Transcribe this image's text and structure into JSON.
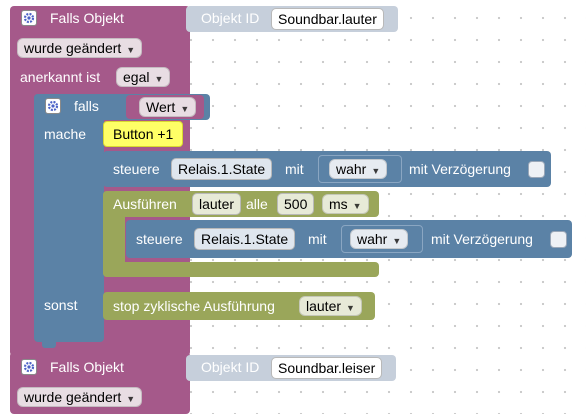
{
  "colors": {
    "trigger_block": "#a5598a",
    "if_block": "#5b82a6",
    "timer_block": "#9aa65a",
    "comment": "#ffff66",
    "value_pill": "#c6cfdb",
    "dropdown_bg": "#e6e6e6"
  },
  "trigger1": {
    "title": "Falls Objekt",
    "object_id_label": "Objekt ID",
    "object_id_value": "Soundbar.lauter",
    "condition_value": "wurde geändert",
    "ack_label": "anerkannt ist",
    "ack_value": "egal"
  },
  "if_block": {
    "if_label": "falls",
    "condition_value": "Wert",
    "do_label": "mache",
    "else_label": "sonst"
  },
  "comment": {
    "text": "Button +1"
  },
  "control1": {
    "label": "steuere",
    "object": "Relais.1.State",
    "with_label": "mit",
    "value": "wahr",
    "delay_label": "mit Verzögerung"
  },
  "interval": {
    "label": "Ausführen",
    "name_value": "lauter",
    "every_label": "alle",
    "number_value": "500",
    "unit_value": "ms"
  },
  "control2": {
    "label": "steuere",
    "object": "Relais.1.State",
    "with_label": "mit",
    "value": "wahr",
    "delay_label": "mit Verzögerung"
  },
  "stop": {
    "label": "stop zyklische Ausführung",
    "name_value": "lauter"
  },
  "trigger2": {
    "title": "Falls Objekt",
    "object_id_label": "Objekt ID",
    "object_id_value": "Soundbar.leiser",
    "condition_value": "wurde geändert"
  },
  "icons": {
    "mutator": "gear-icon",
    "dropdown": "triangle-down-icon"
  }
}
